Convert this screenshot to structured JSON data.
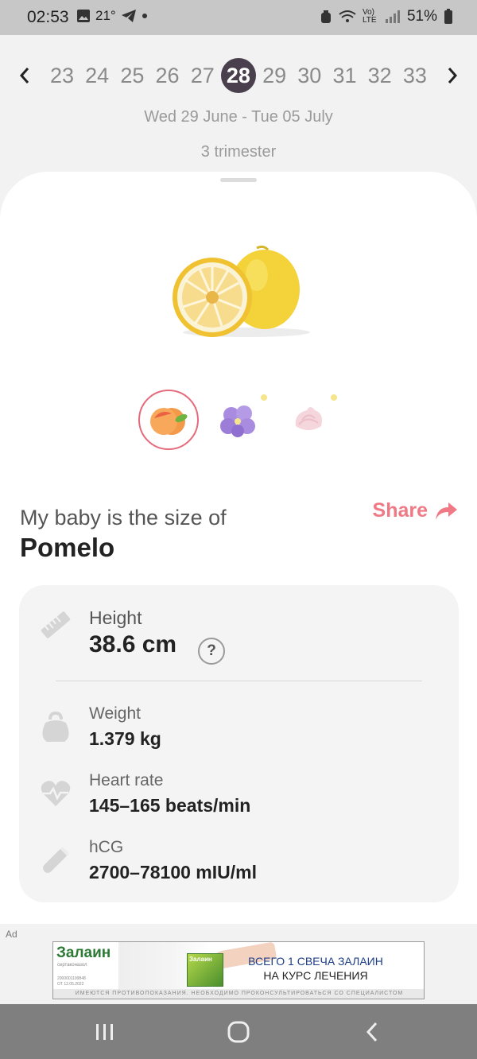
{
  "status_bar": {
    "time": "02:53",
    "temp": "21°",
    "network": "Vo) LTE",
    "battery": "51%"
  },
  "week_selector": {
    "weeks": [
      "23",
      "24",
      "25",
      "26",
      "27",
      "28",
      "29",
      "30",
      "31",
      "32",
      "33"
    ],
    "current_week": "28"
  },
  "date_range": "Wed 29 June - Tue 05 July",
  "trimester": "3 trimester",
  "size": {
    "label": "My baby is the size of",
    "name": "Pomelo",
    "share_label": "Share"
  },
  "thumbnails": [
    {
      "name": "peach",
      "selected": true
    },
    {
      "name": "violet-flower",
      "selected": false
    },
    {
      "name": "marshmallow",
      "selected": false
    }
  ],
  "stats": {
    "height": {
      "label": "Height",
      "value": "38.6 cm",
      "help": "?"
    },
    "weight": {
      "label": "Weight",
      "value": "1.379 kg"
    },
    "heart_rate": {
      "label": "Heart rate",
      "value": "145–165 beats/min"
    },
    "hcg": {
      "label": "hCG",
      "value": "2700–78100 mIU/ml"
    }
  },
  "ad": {
    "tag": "Ad",
    "brand": "Залаин",
    "brand_sub": "сертаконазол",
    "codes": "2000001199848\nОТ 12.05.2022",
    "box_label": "Залаин",
    "headline_1": "ВСЕГО 1 СВЕЧА ЗАЛАИН",
    "headline_2": "НА КУРС ЛЕЧЕНИЯ",
    "disclaimer": "ИМЕЮТСЯ ПРОТИВОПОКАЗАНИЯ. НЕОБХОДИМО ПРОКОНСУЛЬТИРОВАТЬСЯ СО СПЕЦИАЛИСТОМ"
  },
  "colors": {
    "accent": "#ef7a86",
    "active_week": "#4a3f4c"
  }
}
